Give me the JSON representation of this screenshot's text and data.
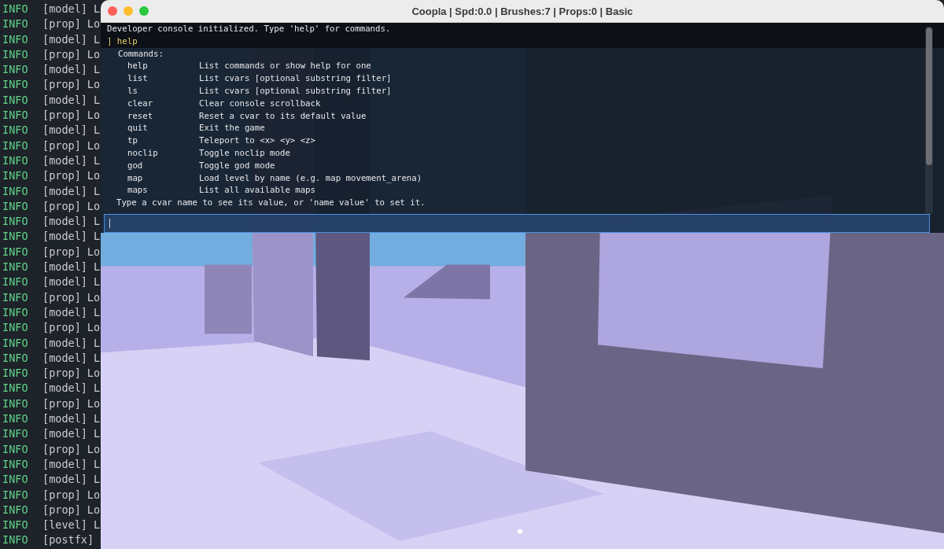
{
  "log": [
    {
      "level": "INFO",
      "tag": "[model]",
      "text": "L"
    },
    {
      "level": "INFO",
      "tag": "[prop]",
      "text": "Lo"
    },
    {
      "level": "INFO",
      "tag": "[model]",
      "text": "L"
    },
    {
      "level": "INFO",
      "tag": "[prop]",
      "text": "Lo"
    },
    {
      "level": "INFO",
      "tag": "[model]",
      "text": "L"
    },
    {
      "level": "INFO",
      "tag": "[prop]",
      "text": "Lo"
    },
    {
      "level": "INFO",
      "tag": "[model]",
      "text": "L"
    },
    {
      "level": "INFO",
      "tag": "[prop]",
      "text": "Lo"
    },
    {
      "level": "INFO",
      "tag": "[model]",
      "text": "L"
    },
    {
      "level": "INFO",
      "tag": "[prop]",
      "text": "Lo"
    },
    {
      "level": "INFO",
      "tag": "[model]",
      "text": "L"
    },
    {
      "level": "INFO",
      "tag": "[prop]",
      "text": "Lo"
    },
    {
      "level": "INFO",
      "tag": "[model]",
      "text": "L"
    },
    {
      "level": "INFO",
      "tag": "[prop]",
      "text": "Lo"
    },
    {
      "level": "INFO",
      "tag": "[model]",
      "text": "L"
    },
    {
      "level": "INFO",
      "tag": "[model]",
      "text": "L"
    },
    {
      "level": "INFO",
      "tag": "[prop]",
      "text": "Lo"
    },
    {
      "level": "INFO",
      "tag": "[model]",
      "text": "L"
    },
    {
      "level": "INFO",
      "tag": "[model]",
      "text": "L"
    },
    {
      "level": "INFO",
      "tag": "[prop]",
      "text": "Lo"
    },
    {
      "level": "INFO",
      "tag": "[model]",
      "text": "L"
    },
    {
      "level": "INFO",
      "tag": "[prop]",
      "text": "Lo"
    },
    {
      "level": "INFO",
      "tag": "[model]",
      "text": "L"
    },
    {
      "level": "INFO",
      "tag": "[model]",
      "text": "L"
    },
    {
      "level": "INFO",
      "tag": "[prop]",
      "text": "Lo"
    },
    {
      "level": "INFO",
      "tag": "[model]",
      "text": "L"
    },
    {
      "level": "INFO",
      "tag": "[prop]",
      "text": "Lo"
    },
    {
      "level": "INFO",
      "tag": "[model]",
      "text": "L"
    },
    {
      "level": "INFO",
      "tag": "[model]",
      "text": "L"
    },
    {
      "level": "INFO",
      "tag": "[prop]",
      "text": "Lo"
    },
    {
      "level": "INFO",
      "tag": "[model]",
      "text": "L"
    },
    {
      "level": "INFO",
      "tag": "[model]",
      "text": "L"
    },
    {
      "level": "INFO",
      "tag": "[prop]",
      "text": "Lo"
    },
    {
      "level": "INFO",
      "tag": "[prop]",
      "text": "Lo"
    },
    {
      "level": "INFO",
      "tag": "[level]",
      "text": "L"
    },
    {
      "level": "INFO",
      "tag": "[postfx]"
    }
  ],
  "window": {
    "title": "Coopla | Spd:0.0 | Brushes:7 | Props:0 | Basic"
  },
  "console": {
    "intro": "Developer console initialized. Type 'help' for commands.",
    "prompt": "] help",
    "heading": "Commands:",
    "commands": [
      {
        "name": "help",
        "description": "List commands or show help for one"
      },
      {
        "name": "list",
        "description": "List cvars [optional substring filter]"
      },
      {
        "name": "ls",
        "description": "List cvars [optional substring filter]"
      },
      {
        "name": "clear",
        "description": "Clear console scrollback"
      },
      {
        "name": "reset",
        "description": "Reset a cvar to its default value"
      },
      {
        "name": "quit",
        "description": "Exit the game"
      },
      {
        "name": "tp",
        "description": "Teleport to <x> <y> <z>"
      },
      {
        "name": "noclip",
        "description": "Toggle noclip mode"
      },
      {
        "name": "god",
        "description": "Toggle god mode"
      },
      {
        "name": "map",
        "description": "Load level by name (e.g. map movement_arena)"
      },
      {
        "name": "maps",
        "description": "List all available maps"
      }
    ],
    "footer": "Type a cvar name to see its value, or 'name value' to set it."
  }
}
